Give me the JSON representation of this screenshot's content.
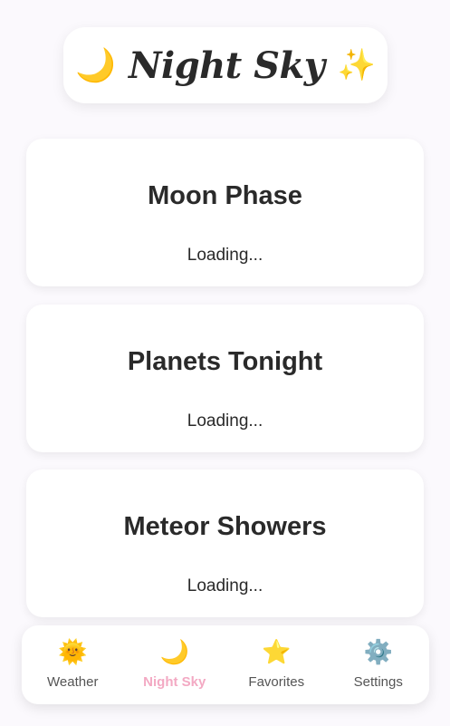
{
  "header": {
    "title": "Night Sky",
    "left_icon": "crescent-moon",
    "right_icon": "sparkles"
  },
  "cards": [
    {
      "title": "Moon Phase",
      "status": "Loading..."
    },
    {
      "title": "Planets Tonight",
      "status": "Loading..."
    },
    {
      "title": "Meteor Showers",
      "status": "Loading..."
    }
  ],
  "nav": {
    "items": [
      {
        "label": "Weather",
        "icon": "sun"
      },
      {
        "label": "Night Sky",
        "icon": "crescent-moon",
        "active": true
      },
      {
        "label": "Favorites",
        "icon": "star"
      },
      {
        "label": "Settings",
        "icon": "gear"
      }
    ],
    "active_color": "#f3a9c3"
  }
}
